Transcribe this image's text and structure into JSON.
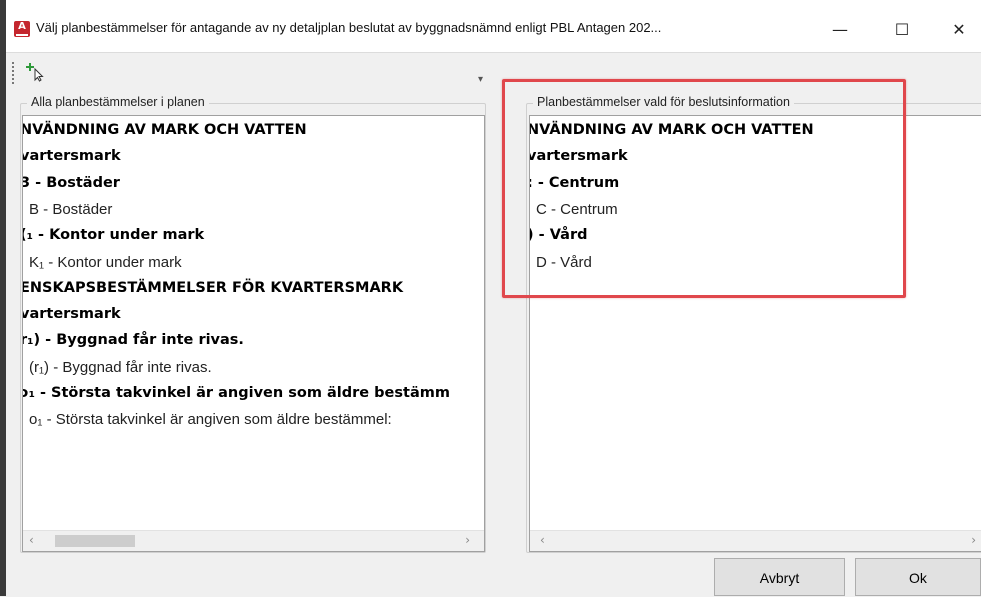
{
  "window": {
    "title": "Välj planbestämmelser för antagande av ny detaljplan beslutat av byggnadsnämnd enligt PBL Antagen 202...",
    "minimize_glyph": "—",
    "maximize_glyph": "☐",
    "close_glyph": "✕",
    "app_icon_letter": "A"
  },
  "toolbar": {
    "add_icon": "add-pointer-icon",
    "overflow_glyph": "▾"
  },
  "left_panel": {
    "label": "Alla planbestämmelser i planen",
    "items": [
      {
        "text": "NVÄNDNING AV MARK OCH VATTEN",
        "bold": true
      },
      {
        "text": "vartersmark",
        "bold": true
      },
      {
        "text": "3 - Bostäder",
        "bold": true
      },
      {
        "text": "B - Bostäder",
        "bold": false
      },
      {
        "text": "(₁ - Kontor under mark",
        "bold": true
      },
      {
        "text": "K₁ - Kontor under mark",
        "bold": false
      },
      {
        "text": "ENSKAPSBESTÄMMELSER FÖR KVARTERSMARK",
        "bold": true
      },
      {
        "text": "vartersmark",
        "bold": true
      },
      {
        "text": "r₁) - Byggnad får inte rivas.",
        "bold": true
      },
      {
        "text": "(r₁) - Byggnad får inte rivas.",
        "bold": false
      },
      {
        "text": "ɔ₁ - Största takvinkel är angiven som äldre bestämm",
        "bold": true
      },
      {
        "text": "o₁ - Största takvinkel är angiven som äldre bestämmel:",
        "bold": false
      }
    ]
  },
  "right_panel": {
    "label": "Planbestämmelser vald för beslutsinformation",
    "items": [
      {
        "text": "NVÄNDNING AV MARK OCH VATTEN",
        "bold": true
      },
      {
        "text": "vartersmark",
        "bold": true
      },
      {
        "text": ": - Centrum",
        "bold": true
      },
      {
        "text": "C - Centrum",
        "bold": false
      },
      {
        "text": ") - Vård",
        "bold": true
      },
      {
        "text": "D - Vård",
        "bold": false
      }
    ]
  },
  "scroll_left_glyph": "‹",
  "scroll_right_glyph": "›",
  "buttons": {
    "cancel": "Avbryt",
    "ok": "Ok"
  },
  "colors": {
    "highlight": "#e0474c",
    "app_icon": "#c4262e"
  }
}
